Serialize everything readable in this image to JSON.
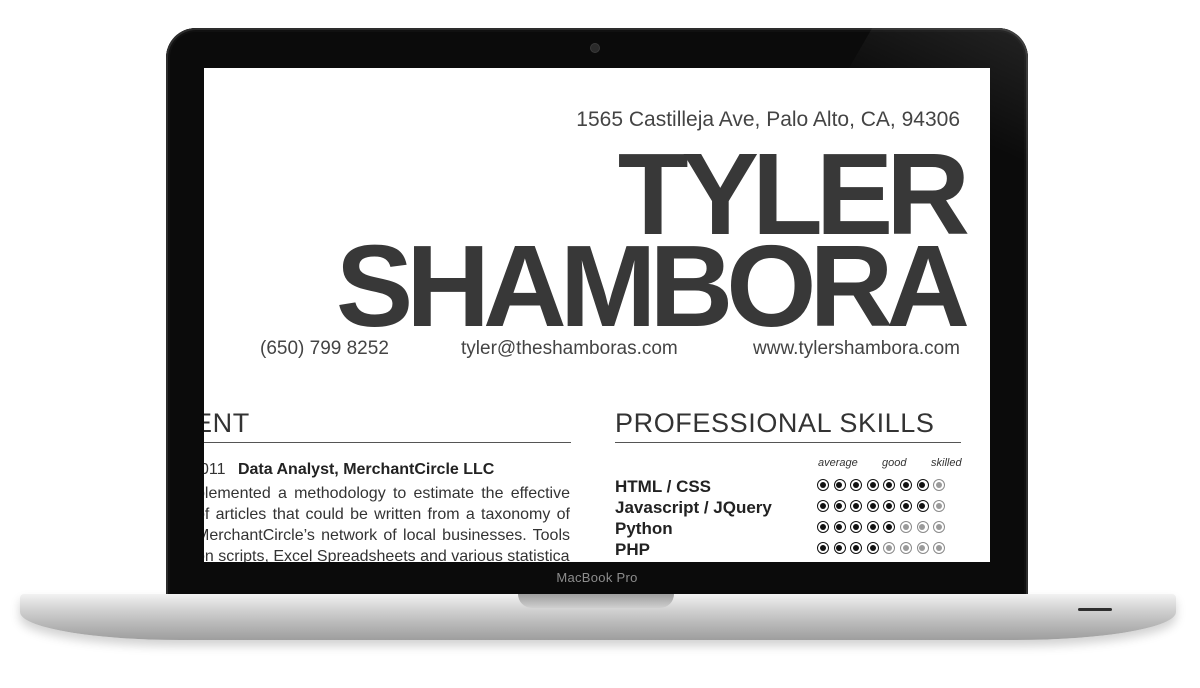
{
  "device": {
    "label": "MacBook Pro"
  },
  "resume": {
    "address": "1565 Castilleja Ave, Palo Alto, CA, 94306",
    "first_name": "TYLER",
    "last_name": "SHAMBORA",
    "phone": "(650) 799 8252",
    "email": "tyler@theshamboras.com",
    "website": "www.tylershambora.com",
    "experience": {
      "title": "ENT",
      "job": {
        "year": "011",
        "role": "Data Analyst, MerchantCircle LLC",
        "lines": [
          "plemented a methodology to estimate the effective",
          "of articles that could be written from a taxonomy of",
          "MerchantCircle’s network of local businesses. Tools",
          "on scripts, Excel Spreadsheets and various statistical"
        ]
      }
    },
    "skills": {
      "title": "PROFESSIONAL SKILLS",
      "scale": {
        "average": "average",
        "good": "good",
        "skilled": "skilled"
      },
      "max_level": 8,
      "items": [
        {
          "name": "HTML / CSS",
          "level": 7
        },
        {
          "name": "Javascript / JQuery",
          "level": 7
        },
        {
          "name": "Python",
          "level": 5
        },
        {
          "name": "PHP",
          "level": 4
        }
      ]
    }
  }
}
